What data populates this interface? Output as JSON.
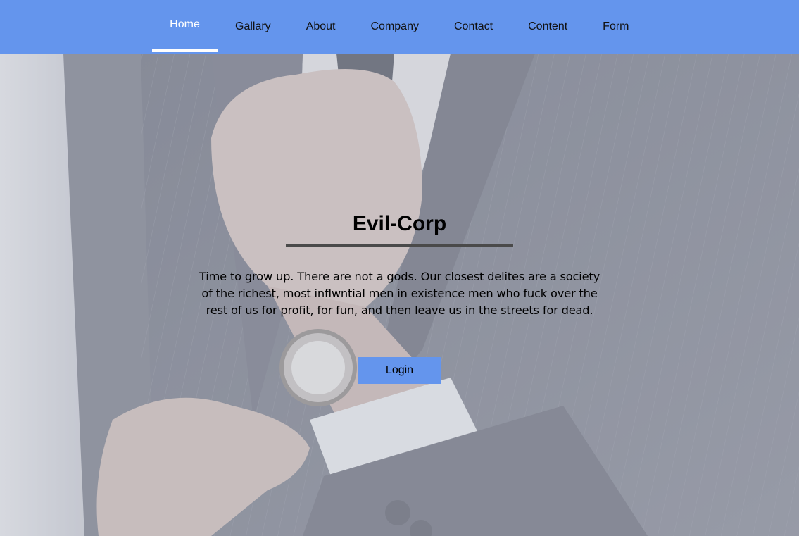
{
  "nav": {
    "items": [
      {
        "label": "Home"
      },
      {
        "label": "Gallary"
      },
      {
        "label": "About"
      },
      {
        "label": "Company"
      },
      {
        "label": "Contact"
      },
      {
        "label": "Content"
      },
      {
        "label": "Form"
      }
    ],
    "active": "Home"
  },
  "hero": {
    "title": "Evil-Corp",
    "text": "Time to grow up. There are not a gods. Our closest delites are a society of the richest, most inflwntial men in existence men who fuck over the rest of us for profit, for fun, and then leave us in the streets for dead.",
    "button_label": "Login"
  },
  "colors": {
    "nav_background": "#6495ed",
    "button_background": "#6495ed",
    "active_indicator": "#ffffff",
    "underline": "#4a4a4a"
  },
  "icons": {
    "background_image": "man-in-suit-adjusting-tie-photo"
  }
}
